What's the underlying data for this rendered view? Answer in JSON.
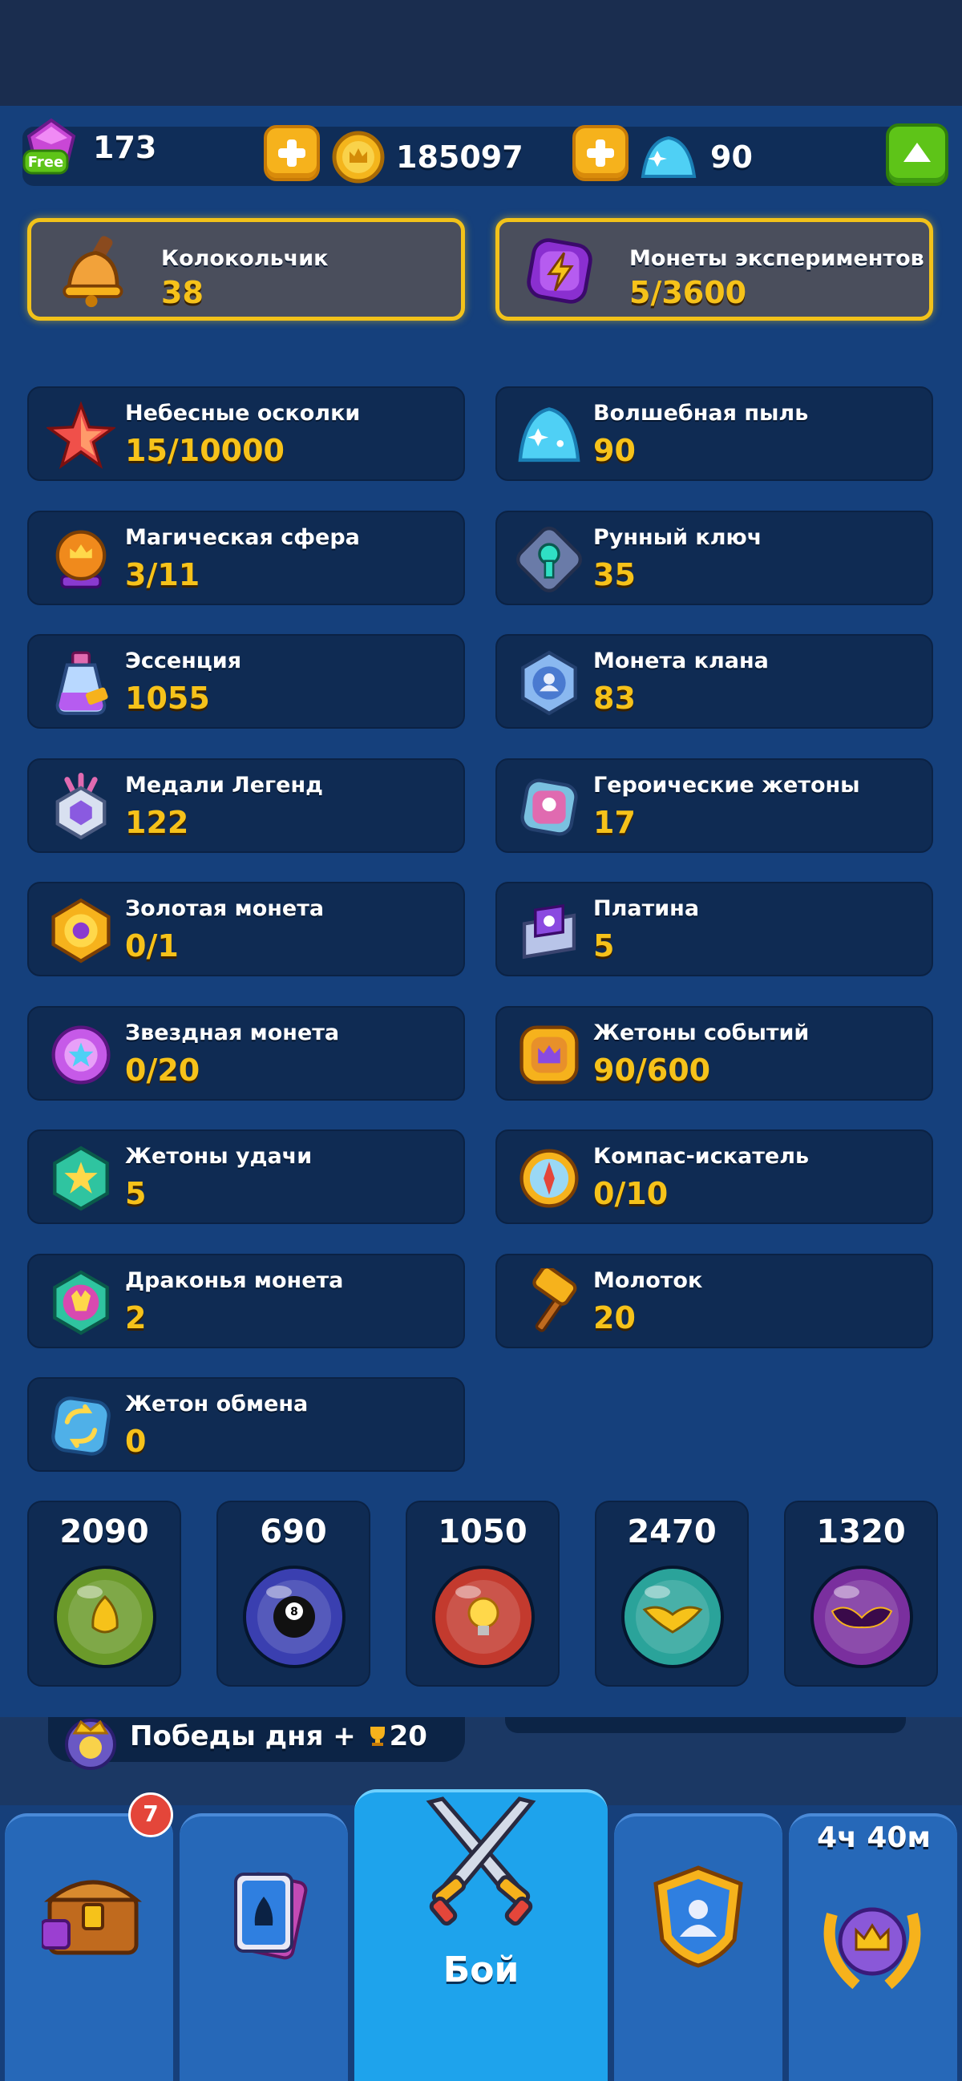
{
  "currency": {
    "gems": "173",
    "gems_badge": "Free",
    "coins": "185097",
    "dust": "90"
  },
  "resources": [
    {
      "name": "Колокольчик",
      "value": "38",
      "highlight": true,
      "icon": "bell-icon"
    },
    {
      "name": "Монеты экспериментов",
      "value": "5/3600",
      "highlight": true,
      "icon": "lightning-icon"
    },
    {
      "name": "Небесные осколки",
      "value": "15/10000",
      "icon": "star-shard-icon"
    },
    {
      "name": "Волшебная пыль",
      "value": "90",
      "icon": "magic-dust-icon"
    },
    {
      "name": "Магическая сфера",
      "value": "3/11",
      "icon": "magic-sphere-icon"
    },
    {
      "name": "Рунный ключ",
      "value": "35",
      "icon": "rune-key-icon"
    },
    {
      "name": "Эссенция",
      "value": "1055",
      "icon": "essence-potion-icon"
    },
    {
      "name": "Монета клана",
      "value": "83",
      "icon": "clan-coin-icon"
    },
    {
      "name": "Медали Легенд",
      "value": "122",
      "icon": "legend-medal-icon"
    },
    {
      "name": "Героические жетоны",
      "value": "17",
      "icon": "heroic-token-icon"
    },
    {
      "name": "Золотая монета",
      "value": "0/1",
      "icon": "gold-coin-icon"
    },
    {
      "name": "Платина",
      "value": "5",
      "icon": "platinum-icon"
    },
    {
      "name": "Звездная монета",
      "value": "0/20",
      "icon": "star-coin-icon"
    },
    {
      "name": "Жетоны событий",
      "value": "90/600",
      "icon": "event-token-icon"
    },
    {
      "name": "Жетоны удачи",
      "value": "5",
      "icon": "luck-token-icon"
    },
    {
      "name": "Компас-искатель",
      "value": "0/10",
      "icon": "compass-icon"
    },
    {
      "name": "Драконья монета",
      "value": "2",
      "icon": "dragon-coin-icon"
    },
    {
      "name": "Молоток",
      "value": "20",
      "icon": "hammer-icon"
    },
    {
      "name": "Жетон обмена",
      "value": "0",
      "icon": "exchange-token-icon"
    }
  ],
  "orbs": [
    {
      "value": "2090",
      "icon": "nature-orb-icon",
      "color": "#6b9a2a"
    },
    {
      "value": "690",
      "icon": "eightball-orb-icon",
      "color": "#3a3fb0"
    },
    {
      "value": "1050",
      "icon": "fire-orb-icon",
      "color": "#c33a2e"
    },
    {
      "value": "2470",
      "icon": "eagle-orb-icon",
      "color": "#2aa39a"
    },
    {
      "value": "1320",
      "icon": "bat-orb-icon",
      "color": "#7a2f9e"
    }
  ],
  "daily": {
    "text": "Победы дня + ",
    "reward": "20"
  },
  "nav": {
    "chest_badge": "7",
    "battle_label": "Бой",
    "timer": "4ч 40м"
  }
}
